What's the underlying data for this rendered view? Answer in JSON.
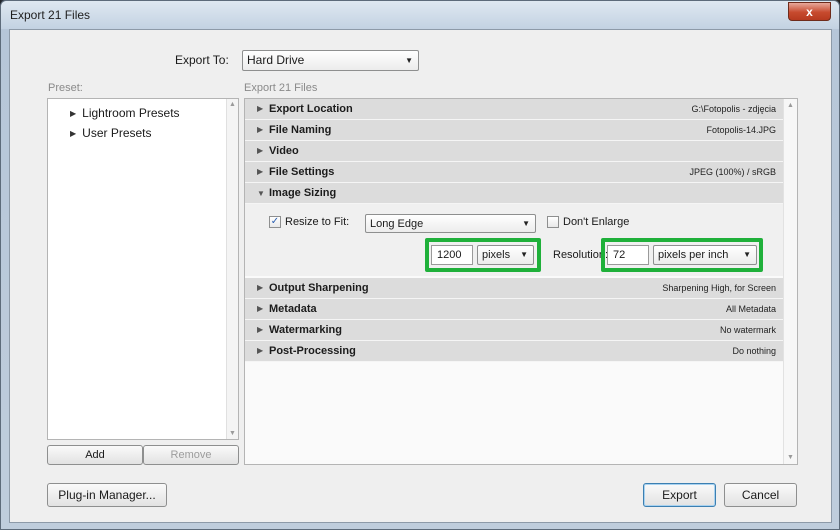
{
  "window": {
    "title": "Export 21 Files",
    "close_glyph": "x"
  },
  "export_to": {
    "label": "Export To:",
    "value": "Hard Drive"
  },
  "preset": {
    "label": "Preset:",
    "items": [
      {
        "label": "Lightroom Presets"
      },
      {
        "label": "User Presets"
      }
    ],
    "add_label": "Add",
    "remove_label": "Remove"
  },
  "settings": {
    "label": "Export 21 Files",
    "sections": [
      {
        "name": "Export Location",
        "summary": "G:\\Fotopolis - zdjęcia",
        "expanded": false
      },
      {
        "name": "File Naming",
        "summary": "Fotopolis-14.JPG",
        "expanded": false
      },
      {
        "name": "Video",
        "summary": "",
        "expanded": false
      },
      {
        "name": "File Settings",
        "summary": "JPEG (100%) / sRGB",
        "expanded": false
      },
      {
        "name": "Image Sizing",
        "summary": "",
        "expanded": true
      },
      {
        "name": "Output Sharpening",
        "summary": "Sharpening High, for Screen",
        "expanded": false
      },
      {
        "name": "Metadata",
        "summary": "All Metadata",
        "expanded": false
      },
      {
        "name": "Watermarking",
        "summary": "No watermark",
        "expanded": false
      },
      {
        "name": "Post-Processing",
        "summary": "Do nothing",
        "expanded": false
      }
    ],
    "image_sizing": {
      "resize_to_fit_label": "Resize to Fit:",
      "resize_to_fit_checked": true,
      "resize_mode": "Long Edge",
      "dont_enlarge_label": "Don't Enlarge",
      "dont_enlarge_checked": false,
      "size_value": "1200",
      "size_unit": "pixels",
      "resolution_label": "Resolution:",
      "resolution_value": "72",
      "resolution_unit": "pixels per inch"
    }
  },
  "footer": {
    "plugin_manager_label": "Plug-in Manager...",
    "export_label": "Export",
    "cancel_label": "Cancel"
  },
  "colors": {
    "highlight": "#1fb03a",
    "close": "#c74a2e"
  }
}
